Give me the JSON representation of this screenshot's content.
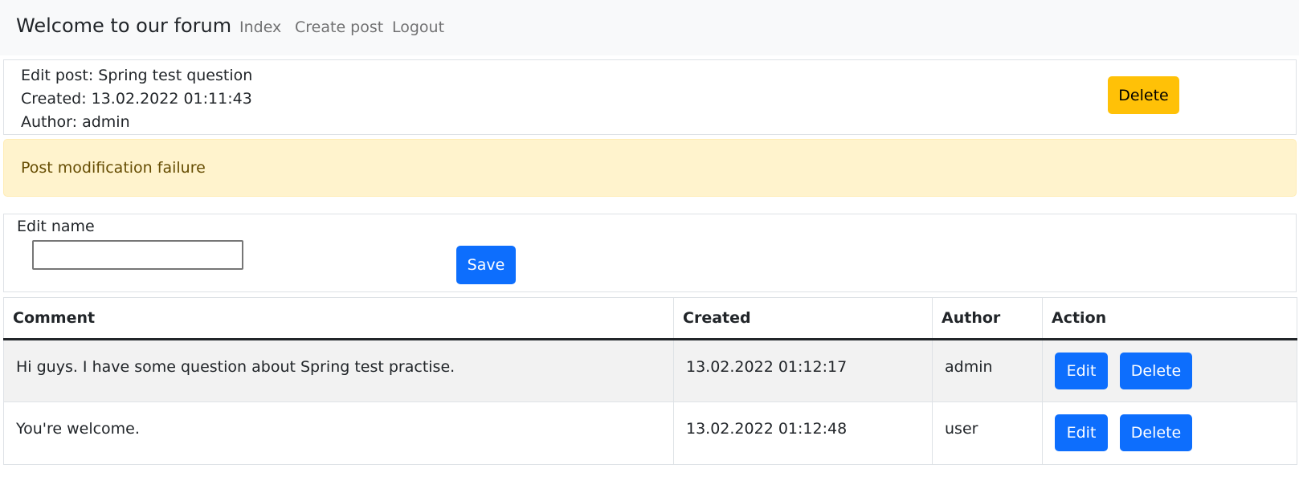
{
  "navbar": {
    "brand": "Welcome to our forum",
    "links": [
      "Index",
      "Create post",
      "Logout"
    ]
  },
  "post": {
    "title_line": "Edit post: Spring test question",
    "created_line": "Created: 13.02.2022 01:11:43",
    "author_line": "Author: admin",
    "delete_label": "Delete"
  },
  "alert": {
    "message": "Post modification failure"
  },
  "edit_form": {
    "label": "Edit name",
    "input_value": "",
    "save_label": "Save"
  },
  "comments": {
    "headers": [
      "Comment",
      "Created",
      "Author",
      "Action"
    ],
    "rows": [
      {
        "comment": "Hi guys. I have some question about Spring test practise.",
        "created": "13.02.2022 01:12:17",
        "author": "admin",
        "edit_label": "Edit",
        "delete_label": "Delete"
      },
      {
        "comment": "You're welcome.",
        "created": "13.02.2022 01:12:48",
        "author": "user",
        "edit_label": "Edit",
        "delete_label": "Delete"
      }
    ]
  },
  "colors": {
    "navbar_bg": "#f8f9fa",
    "warning": "#ffc107",
    "primary": "#0d6efd",
    "alert_bg": "#fff3cd",
    "alert_text": "#664d03",
    "stripe": "#f2f2f2"
  }
}
